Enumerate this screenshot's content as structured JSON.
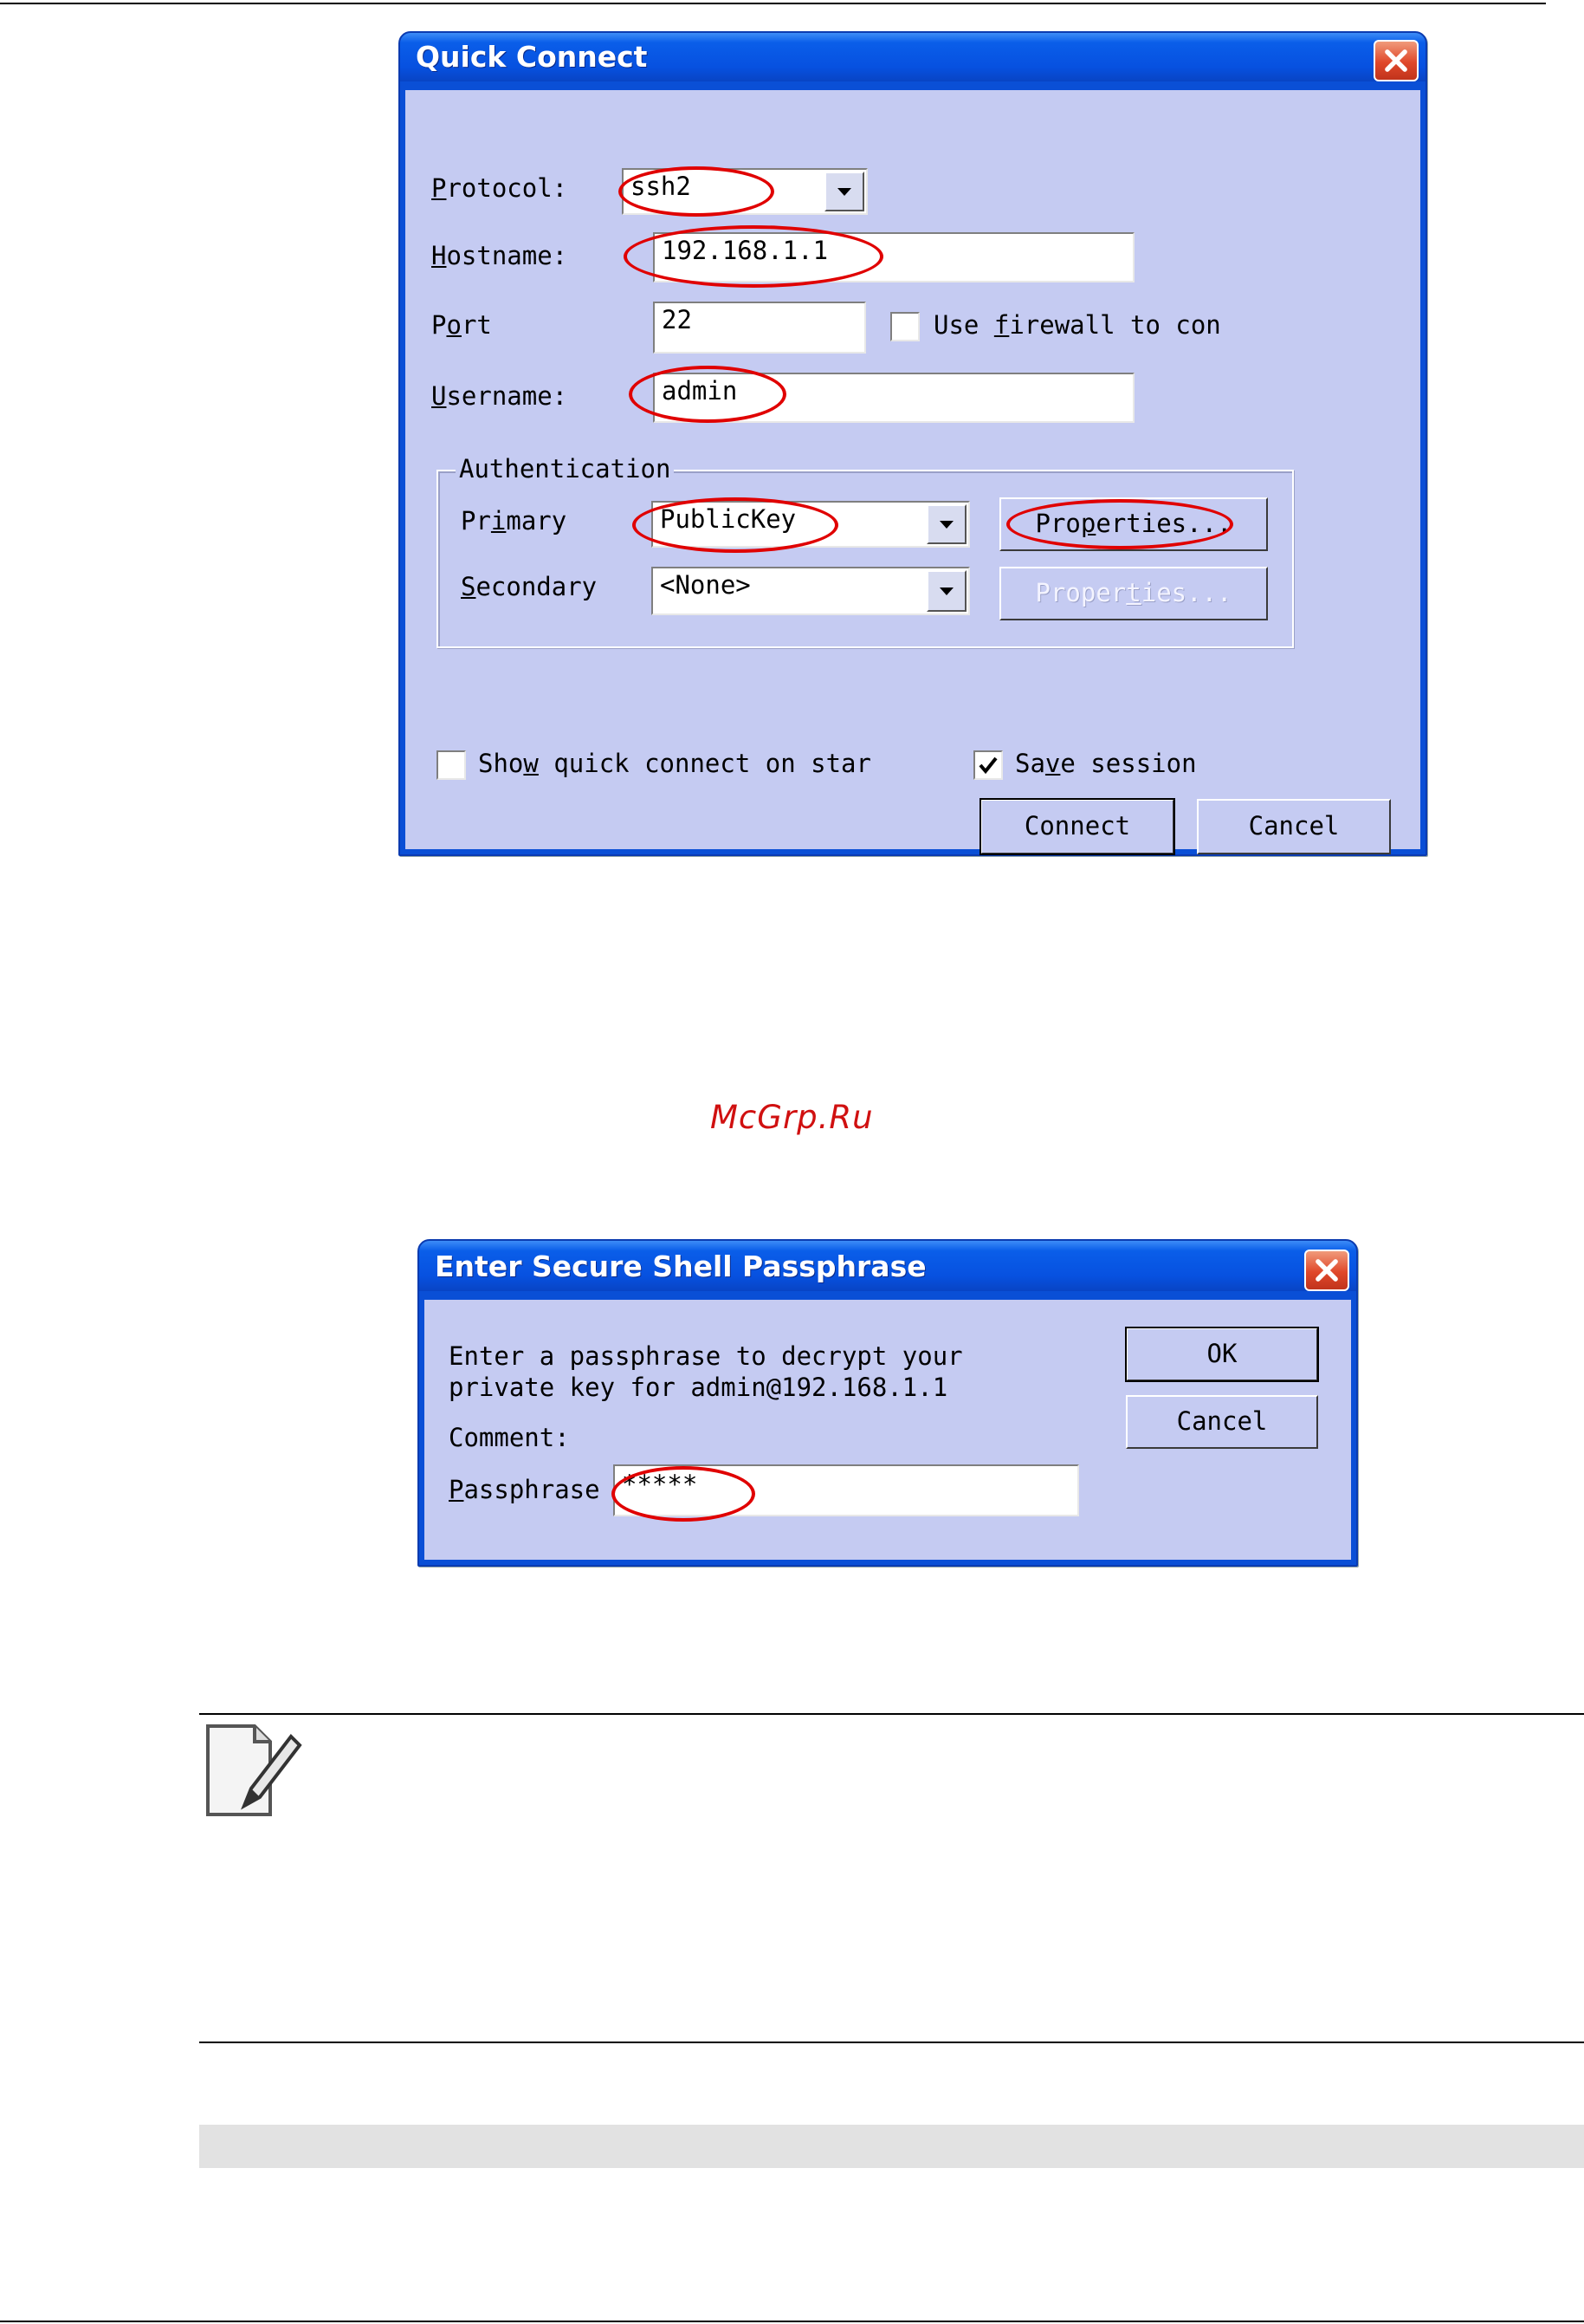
{
  "watermark": "McGrp.Ru",
  "quick_connect": {
    "title": "Quick Connect",
    "protocol": {
      "label_pre": "",
      "label_u": "P",
      "label_post": "rotocol:",
      "value": "ssh2"
    },
    "hostname": {
      "label_u": "H",
      "label_post": "ostname:",
      "value": "192.168.1.1"
    },
    "port": {
      "label_pre": "P",
      "label_u": "o",
      "label_post": "rt",
      "value": "22"
    },
    "firewall": {
      "label_pre": "Use ",
      "label_u": "f",
      "label_post": "irewall to con",
      "checked": false
    },
    "username": {
      "label_u": "U",
      "label_post": "sername:",
      "value": "admin"
    },
    "authentication": {
      "legend": "Authentication",
      "primary": {
        "label_pre": "Pr",
        "label_u": "i",
        "label_post": "mary",
        "value": "PublicKey"
      },
      "secondary": {
        "label_u": "S",
        "label_post": "econdary",
        "value": "<None>"
      },
      "properties_primary": {
        "pre": "Pro",
        "u": "p",
        "post": "erties..."
      },
      "properties_secondary": {
        "pre": "Proper",
        "u": "t",
        "post": "ies..."
      }
    },
    "show_quick_connect": {
      "label_pre": "Sho",
      "label_u": "w",
      "label_post": " quick connect on star",
      "checked": false
    },
    "save_session": {
      "label_pre": "Sa",
      "label_u": "v",
      "label_post": "e session",
      "checked": true
    },
    "connect_label": "Connect",
    "cancel_label": "Cancel"
  },
  "passphrase_dialog": {
    "title": "Enter Secure Shell Passphrase",
    "message_line1": "Enter a passphrase to decrypt your",
    "message_line2": "private key for admin@192.168.1.1",
    "comment_label": "Comment:",
    "passphrase": {
      "label_u": "P",
      "label_post": "assphrase",
      "value": "*****"
    },
    "ok_label": "OK",
    "cancel_label": "Cancel"
  },
  "colors": {
    "xp_blue": "#0a4fd6",
    "dialog_face": "#c5cbf2",
    "annotation_red": "#e00000",
    "watermark_red": "#d01010"
  }
}
